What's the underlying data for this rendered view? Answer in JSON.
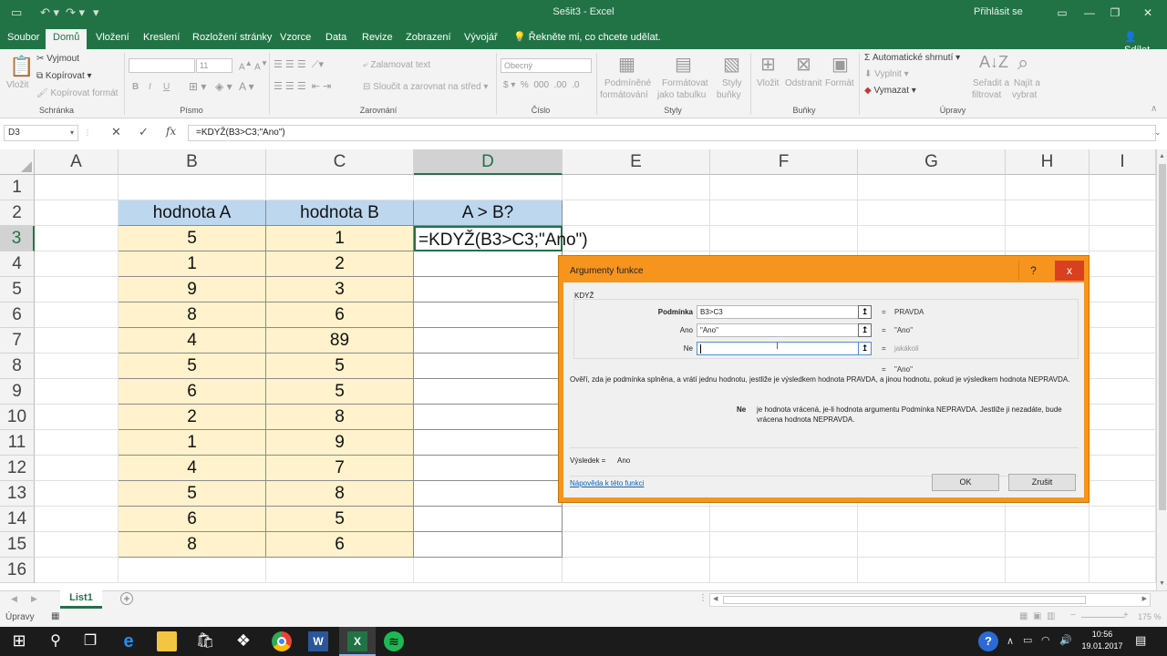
{
  "titlebar": {
    "title": "Sešit3 - Excel",
    "signin": "Přihlásit se",
    "qat": [
      "save-icon",
      "undo-icon",
      "redo-icon",
      "customize-icon"
    ]
  },
  "ribbon_tabs": [
    "Soubor",
    "Domů",
    "Vložení",
    "Kreslení",
    "Rozložení stránky",
    "Vzorce",
    "Data",
    "Revize",
    "Zobrazení",
    "Vývojář"
  ],
  "tellme": "Řekněte mi, co chcete udělat.",
  "share": "Sdílet",
  "ribbon": {
    "clipboard": {
      "paste": "Vložit",
      "cut": "Vyjmout",
      "copy": "Kopírovat",
      "format_painter": "Kopírovat formát",
      "group": "Schránka"
    },
    "font": {
      "size": "11",
      "bold": "B",
      "italic": "I",
      "underline": "U",
      "group": "Písmo"
    },
    "alignment": {
      "wrap": "Zalamovat text",
      "merge": "Sloučit a zarovnat na střed",
      "group": "Zarovnání"
    },
    "number": {
      "format": "Obecný",
      "group": "Číslo"
    },
    "styles": {
      "conditional": "Podmíněné",
      "conditional2": "formátování",
      "table": "Formátovat",
      "table2": "jako tabulku",
      "cell": "Styly",
      "cell2": "buňky",
      "group": "Styly"
    },
    "cells": {
      "insert": "Vložit",
      "delete": "Odstranit",
      "format": "Formát",
      "group": "Buňky"
    },
    "editing": {
      "autosum": "Automatické shrnutí",
      "fill": "Vyplnit",
      "clear": "Vymazat",
      "sort": "Seřadit a",
      "sort2": "filtrovat",
      "find": "Najít a",
      "find2": "vybrat",
      "group": "Úpravy"
    }
  },
  "namebox": "D3",
  "formula": "=KDYŽ(B3>C3;\"Ano\")",
  "columns": [
    "A",
    "B",
    "C",
    "D",
    "E",
    "F",
    "G",
    "H",
    "I"
  ],
  "rows": [
    "1",
    "2",
    "3",
    "4",
    "5",
    "6",
    "7",
    "8",
    "9",
    "10",
    "11",
    "12",
    "13",
    "14",
    "15",
    "16"
  ],
  "table": {
    "headers": [
      "hodnota A",
      "hodnota B",
      "A > B?"
    ],
    "b": [
      "5",
      "1",
      "9",
      "8",
      "4",
      "5",
      "6",
      "2",
      "1",
      "4",
      "5",
      "6",
      "8"
    ],
    "c": [
      "1",
      "2",
      "3",
      "6",
      "89",
      "5",
      "5",
      "8",
      "9",
      "7",
      "8",
      "5",
      "6"
    ],
    "d3": "=KDYŽ(B3>C3;\"Ano\")"
  },
  "sheet_tab": "List1",
  "status": {
    "mode": "Úpravy",
    "zoom": "175 %"
  },
  "taskbar": {
    "time": "10:56",
    "date": "19.01.2017"
  },
  "dialog": {
    "title": "Argumenty funkce",
    "help": "?",
    "close": "x",
    "function": "KDYŽ",
    "args": [
      {
        "label": "Podmínka",
        "value": "B3>C3",
        "result": "PRAVDA"
      },
      {
        "label": "Ano",
        "value": "\"Ano\"",
        "result": "\"Ano\""
      },
      {
        "label": "Ne",
        "value": "",
        "result": "jakákoli"
      }
    ],
    "eq": "=",
    "overall_result": "\"Ano\"",
    "description": "Ověří, zda je podmínka splněna, a vrátí jednu hodnotu, jestliže je výsledkem hodnota PRAVDA, a jinou hodnotu, pokud je výsledkem hodnota NEPRAVDA.",
    "arg_name": "Ne",
    "arg_help": "je hodnota vrácená, je-li hodnota argumentu Podmínka NEPRAVDA. Jestliže ji nezadáte, bude vrácena hodnota NEPRAVDA.",
    "result_label": "Výsledek =",
    "result_value": "Ano",
    "help_link": "Nápověda k této funkci",
    "ok": "OK",
    "cancel": "Zrušit"
  },
  "colors": {
    "excel_green": "#217346",
    "header_fill": "#bdd7ee",
    "data_fill": "#fff2cc",
    "dialog_border": "#f7941d"
  }
}
